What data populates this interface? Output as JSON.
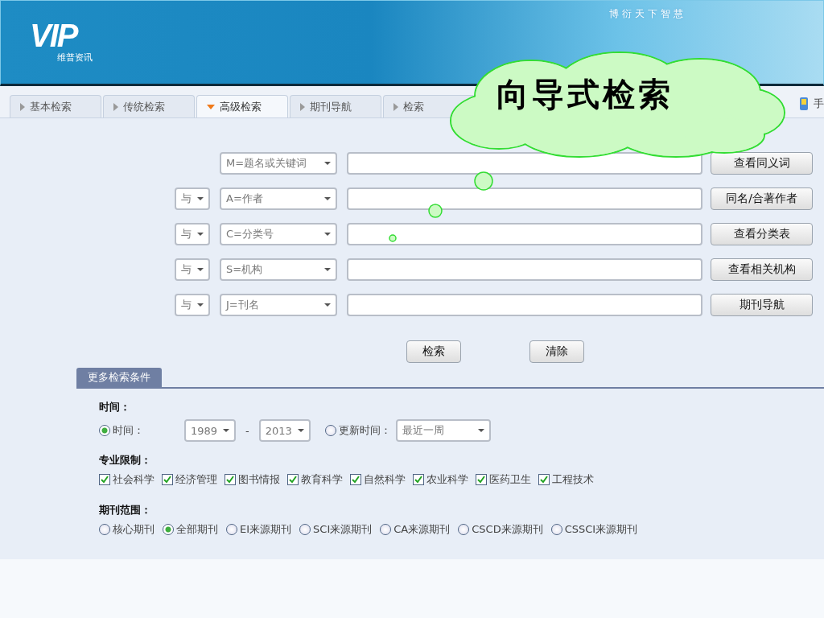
{
  "header": {
    "logo_text": "VIP",
    "logo_subtitle": "维普资讯",
    "slogan": "博衍天下智慧"
  },
  "tabs": [
    {
      "label": "基本检索",
      "selected": false
    },
    {
      "label": "传统检索",
      "selected": false
    },
    {
      "label": "高级检索",
      "selected": true
    },
    {
      "label": "期刊导航",
      "selected": false
    },
    {
      "label": "检索",
      "selected": false
    }
  ],
  "tab_bar_right": {
    "label": "手"
  },
  "callout": {
    "text": "向导式检索"
  },
  "search_rows": [
    {
      "operator": null,
      "field": "M=题名或关键词",
      "button": "查看同义词"
    },
    {
      "operator": "与",
      "field": "A=作者",
      "button": "同名/合著作者"
    },
    {
      "operator": "与",
      "field": "C=分类号",
      "button": "查看分类表"
    },
    {
      "operator": "与",
      "field": "S=机构",
      "button": "查看相关机构"
    },
    {
      "operator": "与",
      "field": "J=刊名",
      "button": "期刊导航"
    }
  ],
  "actions": [
    "检索",
    "清除"
  ],
  "more_conditions": {
    "tab_label": "更多检索条件",
    "time": {
      "heading": "时间：",
      "options": [
        {
          "label": "时间：",
          "selected": true,
          "kind": "range",
          "from": "1989",
          "to": "2013",
          "separator": "-"
        },
        {
          "label": "更新时间：",
          "selected": false,
          "kind": "period",
          "value": "最近一周"
        }
      ]
    },
    "subjects": {
      "heading": "专业限制：",
      "items": [
        {
          "label": "社会科学",
          "checked": true
        },
        {
          "label": "经济管理",
          "checked": true
        },
        {
          "label": "图书情报",
          "checked": true
        },
        {
          "label": "教育科学",
          "checked": true
        },
        {
          "label": "自然科学",
          "checked": true
        },
        {
          "label": "农业科学",
          "checked": true
        },
        {
          "label": "医药卫生",
          "checked": true
        },
        {
          "label": "工程技术",
          "checked": true
        }
      ]
    },
    "journal_scope": {
      "heading": "期刊范围：",
      "items": [
        {
          "label": "核心期刊",
          "selected": false
        },
        {
          "label": "全部期刊",
          "selected": true
        },
        {
          "label": "EI来源期刊",
          "selected": false
        },
        {
          "label": "SCI来源期刊",
          "selected": false
        },
        {
          "label": "CA来源期刊",
          "selected": false
        },
        {
          "label": "CSCD来源期刊",
          "selected": false
        },
        {
          "label": "CSSCI来源期刊",
          "selected": false
        }
      ]
    }
  }
}
